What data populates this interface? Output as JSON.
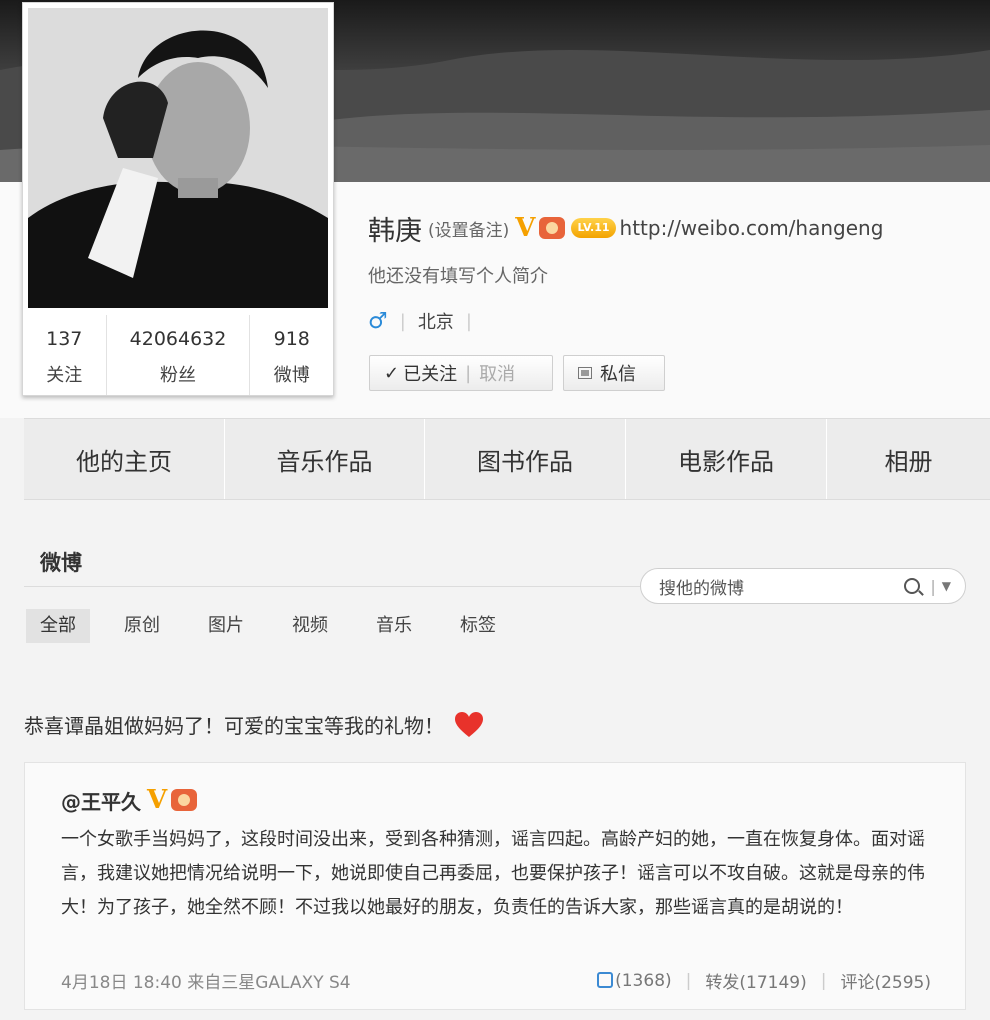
{
  "profile": {
    "name": "韩庚",
    "remark": "(设置备注)",
    "level_badge": "LV.11",
    "url": "http://weibo.com/hangeng",
    "bio": "他还没有填写个人简介",
    "gender_symbol": "♂",
    "location": "北京"
  },
  "stats": [
    {
      "num": "137",
      "label": "关注"
    },
    {
      "num": "42064632",
      "label": "粉丝"
    },
    {
      "num": "918",
      "label": "微博"
    }
  ],
  "actions": {
    "followed_label": "已关注",
    "cancel_label": "取消",
    "message_label": "私信"
  },
  "tabs": [
    "他的主页",
    "音乐作品",
    "图书作品",
    "电影作品",
    "相册"
  ],
  "feed": {
    "title": "微博",
    "search_placeholder": "搜他的微博",
    "filters": [
      "全部",
      "原创",
      "图片",
      "视频",
      "音乐",
      "标签"
    ]
  },
  "post": {
    "text": "恭喜谭晶姐做妈妈了！可爱的宝宝等我的礼物！",
    "repost": {
      "user": "@王平久",
      "body": "一个女歌手当妈妈了，这段时间没出来，受到各种猜测，谣言四起。高龄产妇的她，一直在恢复身体。面对谣言，我建议她把情况给说明一下，她说即使自己再委屈，也要保护孩子！谣言可以不攻自破。这就是母亲的伟大！为了孩子，她全然不顾！不过我以她最好的朋友，负责任的告诉大家，那些谣言真的是胡说的！",
      "time": "4月18日 18:40",
      "source": "来自三星GALAXY S4",
      "likes": "(1368)",
      "forward": "转发(17149)",
      "comment": "评论(2595)"
    }
  },
  "colors": {
    "verified": "#f5a000",
    "gender": "#2a8ad8",
    "heart": "#e8322b"
  }
}
